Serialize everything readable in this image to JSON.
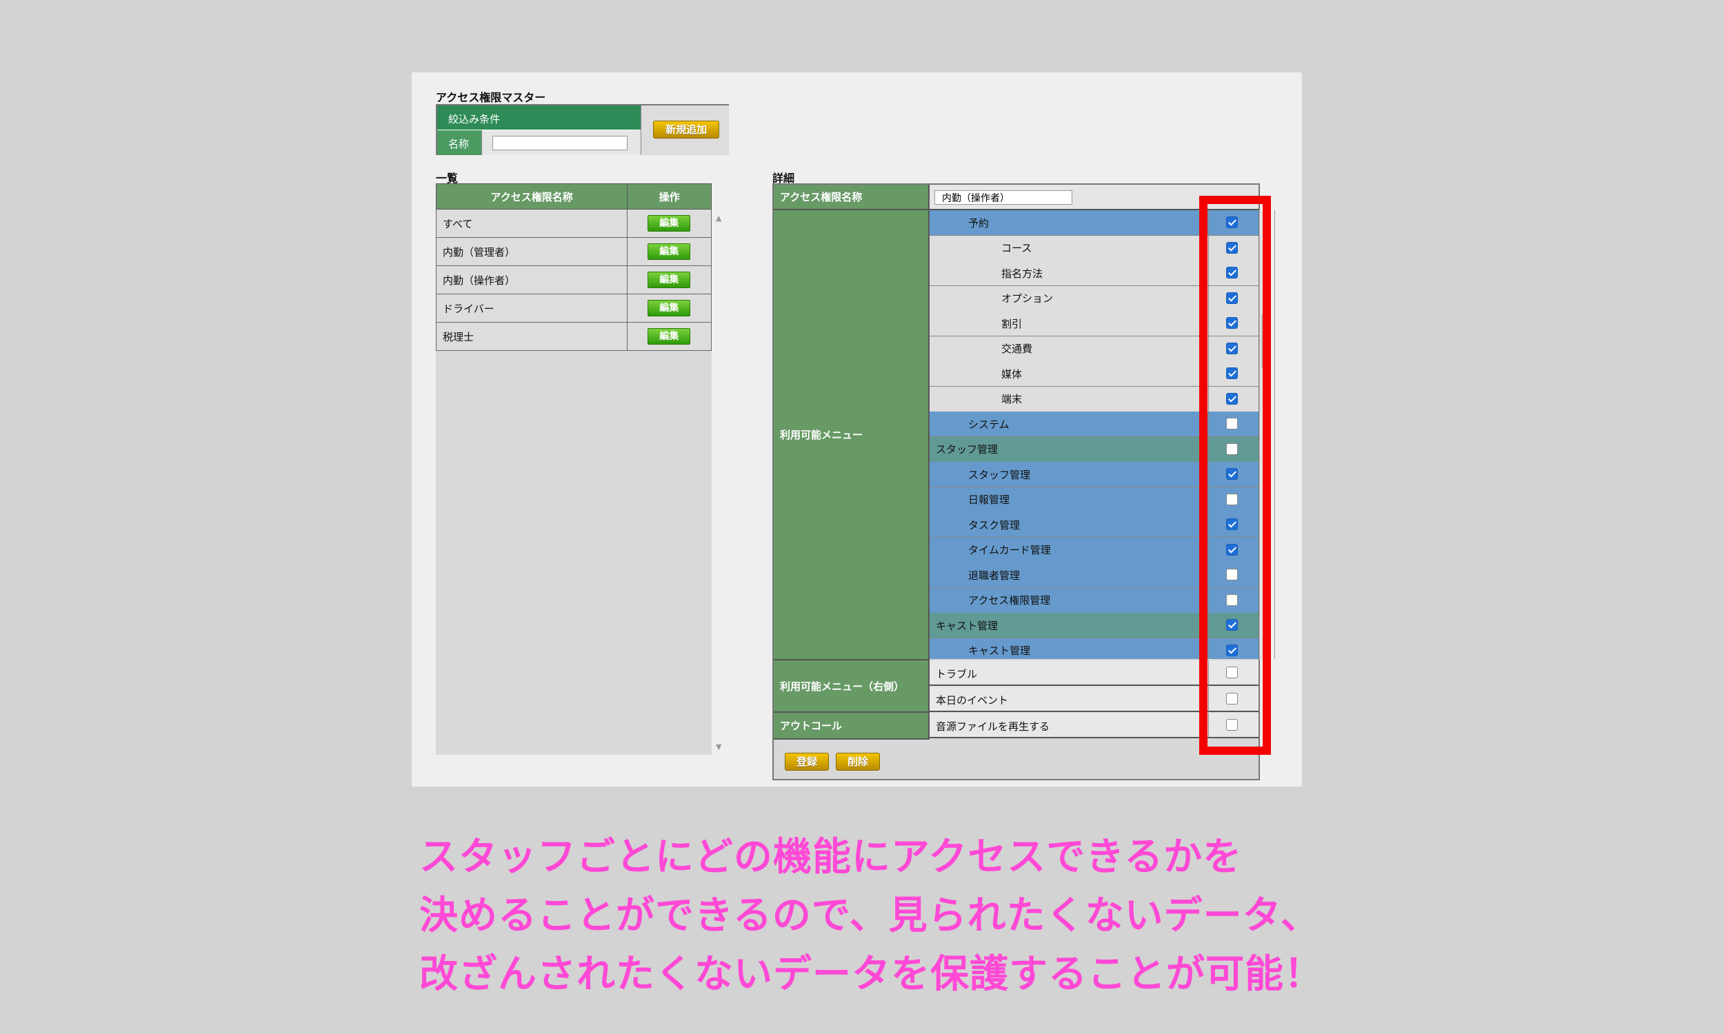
{
  "header": {
    "page_title": "アクセス権限マスター",
    "filter_title": "絞込み条件",
    "filter_name_label": "名称",
    "filter_name_value": "",
    "add_button": "新規追加"
  },
  "list": {
    "title": "一覧",
    "columns": [
      "アクセス権限名称",
      "操作"
    ],
    "rows": [
      {
        "name": "すべて",
        "action": "編集"
      },
      {
        "name": "内勤（管理者）",
        "action": "編集"
      },
      {
        "name": "内勤（操作者）",
        "action": "編集"
      },
      {
        "name": "ドライバー",
        "action": "編集"
      },
      {
        "name": "税理士",
        "action": "編集"
      }
    ]
  },
  "detail": {
    "title": "詳細",
    "name_label": "アクセス権限名称",
    "name_value": "内勤（操作者）",
    "menu_label": "利用可能メニュー",
    "menu_items": [
      {
        "label": "予約",
        "level": "l1",
        "checked": true
      },
      {
        "label": "コース",
        "level": "l2",
        "checked": true
      },
      {
        "label": "指名方法",
        "level": "l2",
        "checked": true
      },
      {
        "label": "オプション",
        "level": "l2",
        "checked": true
      },
      {
        "label": "割引",
        "level": "l2",
        "checked": true
      },
      {
        "label": "交通費",
        "level": "l2",
        "checked": true
      },
      {
        "label": "媒体",
        "level": "l2",
        "checked": true
      },
      {
        "label": "端末",
        "level": "l2",
        "checked": true
      },
      {
        "label": "システム",
        "level": "l1",
        "checked": false
      },
      {
        "label": "スタッフ管理",
        "level": "grp",
        "checked": false
      },
      {
        "label": "スタッフ管理",
        "level": "l1",
        "checked": true
      },
      {
        "label": "日報管理",
        "level": "l1",
        "checked": false
      },
      {
        "label": "タスク管理",
        "level": "l1",
        "checked": true
      },
      {
        "label": "タイムカード管理",
        "level": "l1",
        "checked": true
      },
      {
        "label": "退職者管理",
        "level": "l1",
        "checked": false
      },
      {
        "label": "アクセス権限管理",
        "level": "l1",
        "checked": false
      },
      {
        "label": "キャスト管理",
        "level": "grp",
        "checked": true
      },
      {
        "label": "キャスト管理",
        "level": "l1",
        "checked": true
      }
    ],
    "right_menu_label": "利用可能メニュー（右側）",
    "right_menu_items": [
      {
        "label": "トラブル",
        "checked": false
      },
      {
        "label": "本日のイベント",
        "checked": false
      }
    ],
    "outcall_label": "アウトコール",
    "outcall_items": [
      {
        "label": "音源ファイルを再生する",
        "checked": false
      }
    ],
    "register_button": "登録",
    "delete_button": "削除"
  },
  "caption": {
    "line1": "スタッフごとにどの機能にアクセスできるかを",
    "line2": "決めることができるので、見られたくないデータ、",
    "line3": "改ざんされたくないデータを保護することが可能！"
  },
  "colors": {
    "highlight_frame": "#f40000",
    "caption_text": "#ff49d6",
    "header_green": "#689a66",
    "row_blue": "#669acc"
  }
}
